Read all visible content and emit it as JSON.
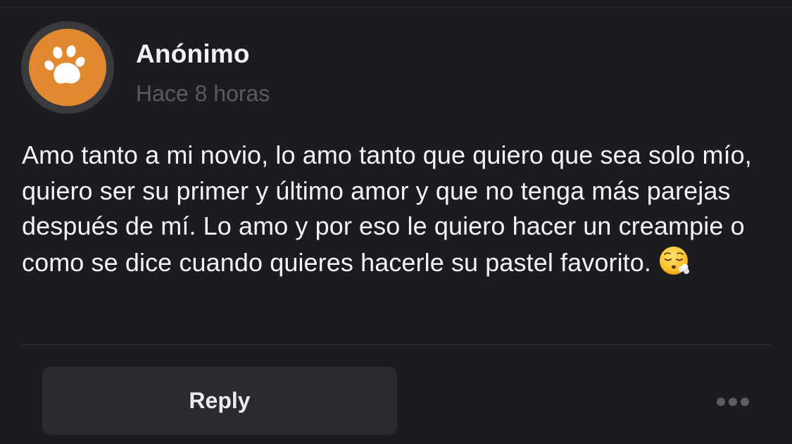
{
  "post": {
    "author": "Anónimo",
    "timestamp": "Hace 8 horas",
    "body": "Amo tanto a mi novio, lo amo tanto que quiero que sea solo mío, quiero ser su primer y último amor y que no tenga más parejas después de mí. Lo amo y por eso le quiero hacer un creampie o como se dice cuando quieres hacerle su pastel favorito.",
    "emoji": "face-exhaling-icon",
    "avatar_icon": "paw-icon"
  },
  "actions": {
    "reply_label": "Reply",
    "more_icon": "more-dots-icon"
  },
  "colors": {
    "background": "#1c1c20",
    "avatar_ring": "#39393e",
    "avatar_fill": "#e0892f",
    "author_text": "#f2f2f4",
    "timestamp_text": "#5a5a60",
    "button_bg": "#2a2a2f",
    "dots": "#5c5c62"
  }
}
